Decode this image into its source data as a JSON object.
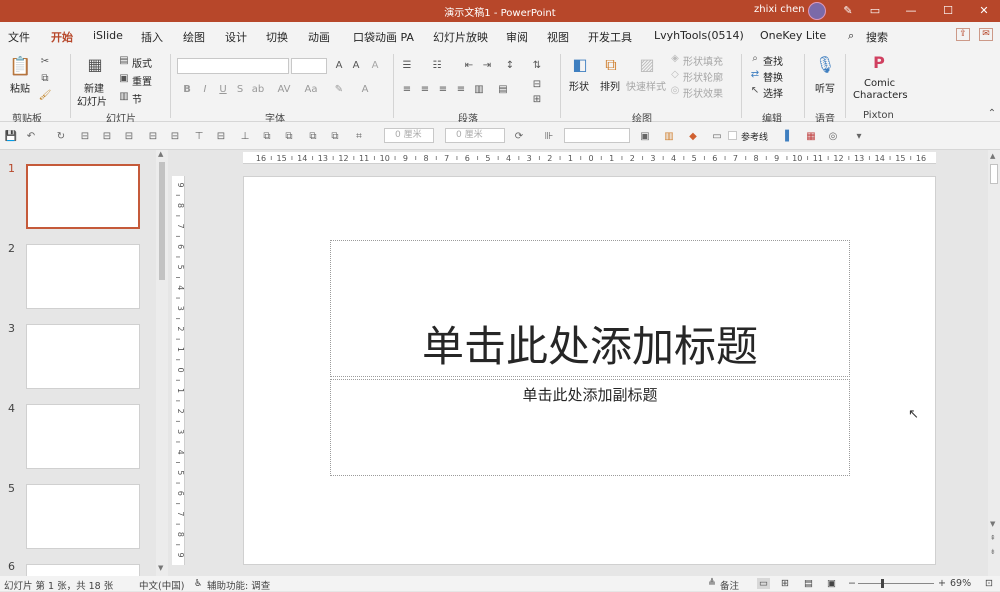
{
  "window": {
    "title": "演示文稿1  -  PowerPoint",
    "user": "zhixi chen",
    "controls": [
      "pen-icon",
      "ribbon-display-icon",
      "minimize-icon",
      "maximize-icon",
      "close-icon"
    ]
  },
  "tabs": [
    "文件",
    "开始",
    "iSlide",
    "插入",
    "绘图",
    "设计",
    "切换",
    "动画",
    "口袋动画 PA",
    "幻灯片放映",
    "审阅",
    "视图",
    "开发工具",
    "LvyhTools(0514)",
    "OneKey Lite",
    "搜索"
  ],
  "active_tab": "开始",
  "ribbon": {
    "clipboard": {
      "paste": "粘贴",
      "label": "剪贴板"
    },
    "slides": {
      "new_line1": "新建",
      "new_line2": "幻灯片",
      "layout": "版式",
      "reset": "重置",
      "section": "节",
      "label": "幻灯片"
    },
    "font": {
      "label": "字体"
    },
    "paragraph": {
      "label": "段落"
    },
    "drawing": {
      "shapes": "形状",
      "arrange": "排列",
      "quick_styles": "快速样式",
      "fill": "形状填充",
      "outline": "形状轮廓",
      "effects": "形状效果",
      "label": "绘图"
    },
    "editing": {
      "find": "查找",
      "replace": "替换",
      "select": "选择",
      "label": "编辑"
    },
    "voice": {
      "dictate": "听写",
      "label": "语音"
    },
    "pixton": {
      "line1": "Comic",
      "line2": "Characters",
      "label": "Pixton"
    }
  },
  "qat": {
    "size1": "0 厘米",
    "size2": "0 厘米",
    "guides": "参考线"
  },
  "slides_panel": {
    "numbers": [
      "1",
      "2",
      "3",
      "4",
      "5",
      "6"
    ],
    "selected": "1"
  },
  "rulers": {
    "h_ticks": [
      "16",
      "15",
      "14",
      "13",
      "12",
      "11",
      "10",
      "9",
      "8",
      "7",
      "6",
      "5",
      "4",
      "3",
      "2",
      "1",
      "0",
      "1",
      "2",
      "3",
      "4",
      "5",
      "6",
      "7",
      "8",
      "9",
      "10",
      "11",
      "12",
      "13",
      "14",
      "15",
      "16"
    ],
    "v_ticks": [
      "9",
      "8",
      "7",
      "6",
      "5",
      "4",
      "3",
      "2",
      "1",
      "0",
      "1",
      "2",
      "3",
      "4",
      "5",
      "6",
      "7",
      "8",
      "9"
    ]
  },
  "slide": {
    "title_placeholder": "单击此处添加标题",
    "subtitle_placeholder": "单击此处添加副标题"
  },
  "status": {
    "slide_info": "幻灯片 第 1 张，共 18 张",
    "language": "中文(中国)",
    "accessibility": "辅助功能: 调查",
    "notes": "备注",
    "zoom": "69%"
  },
  "colors": {
    "accent": "#b7472a",
    "ribbon_bg": "#f3f3f3",
    "canvas_bg": "#e6e6e6"
  }
}
